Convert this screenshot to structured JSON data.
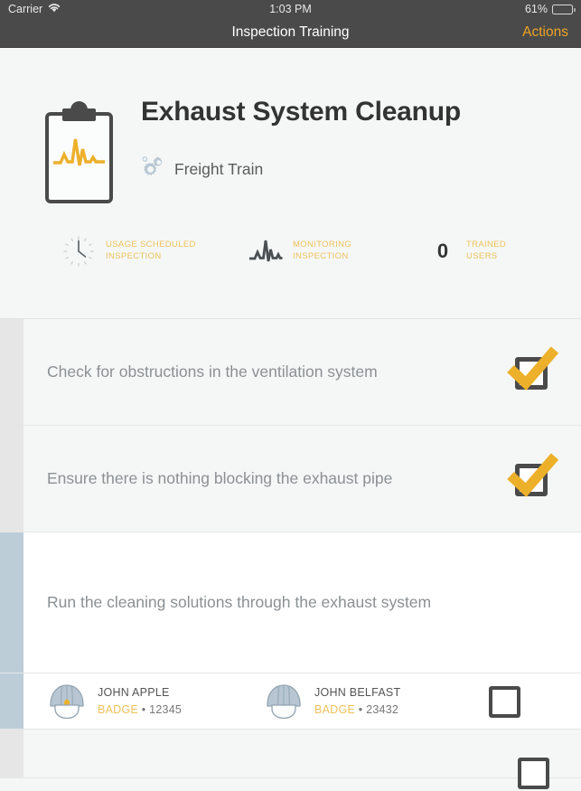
{
  "status_bar": {
    "carrier": "Carrier",
    "wifi_icon": "wifi-icon",
    "time": "1:03 PM",
    "battery_percent": "61%",
    "battery_level": 61
  },
  "nav_bar": {
    "title": "Inspection Training",
    "action_label": "Actions",
    "accent_color": "#eda526"
  },
  "header": {
    "icon": "clipboard-waveform-icon",
    "title": "Exhaust System Cleanup",
    "subtitle_icon": "gears-icon",
    "subtitle": "Freight Train",
    "stats": [
      {
        "icon": "clock-icon",
        "value": "",
        "label_line1": "USAGE SCHEDULED",
        "label_line2": "INSPECTION"
      },
      {
        "icon": "waveform-icon",
        "value": "",
        "label_line1": "MONITORING",
        "label_line2": "INSPECTION"
      },
      {
        "icon": "",
        "value": "0",
        "label_line1": "TRAINED",
        "label_line2": "USERS"
      }
    ]
  },
  "list": {
    "rows": [
      {
        "label": "Check for obstructions in the ventilation system",
        "checked": true,
        "active": false
      },
      {
        "label": "Ensure there is nothing blocking the exhaust pipe",
        "checked": true,
        "active": false
      },
      {
        "label": "Run the cleaning solutions through the exhaust system",
        "checked": false,
        "active": true
      }
    ],
    "users_row": {
      "checked": false,
      "users": [
        {
          "icon": "hardhat-icon",
          "name": "JOHN APPLE",
          "badge_label": "BADGE",
          "badge_separator": "•",
          "badge_number": "12345"
        },
        {
          "icon": "hardhat-icon",
          "name": "JOHN BELFAST",
          "badge_label": "BADGE",
          "badge_separator": "•",
          "badge_number": "23432"
        }
      ]
    }
  },
  "colors": {
    "accent_yellow": "#eeb game",
    "accent_gold": "#edb02a",
    "label_gold": "#eec25a",
    "nav_background": "#4a4a4a",
    "page_background": "#f5f7f7",
    "active_strip": "#bccdd8",
    "inactive_strip": "#e6e6e6",
    "helmet_blue": "#b7c6d2"
  }
}
